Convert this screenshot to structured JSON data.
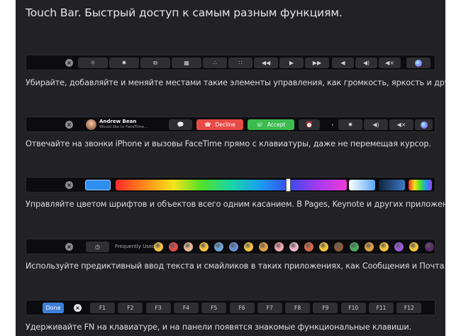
{
  "title": "Touch Bar. Быстрый доступ к самым разным функциям.",
  "rows": [
    {
      "caption": "Убирайте, добавляйте и меняйте местами такие элементы управления, как громкость, яркость и другие.",
      "keys": [
        "☼",
        "✹",
        "⧉",
        "▦",
        "∴",
        "∷",
        "◀◀",
        "▶",
        "▶▶",
        "◀",
        "◀)",
        "◀×"
      ]
    },
    {
      "caption": "Отвечайте на звонки iPhone и вызовы FaceTime прямо с клавиатуры, даже не перемещая курсор.",
      "caller_name": "Andrew Bean",
      "caller_status": "Would like to FaceTime…",
      "decline_label": "Decline",
      "accept_label": "Accept",
      "message_icon": "💬",
      "alarm_icon": "⏰",
      "controls": [
        "‹",
        "✹",
        "◀)",
        "◀×"
      ]
    },
    {
      "caption": "Управляйте цветом шрифтов и объектов всего одним касанием. В Pages, Keynote и других приложениях.",
      "selected_color": "#2f8ff0"
    },
    {
      "caption": "Используйте предиктивный ввод текста и смайликов в таких приложениях, как Сообщения и Почта.",
      "frequently_used_label": "Frequently Used",
      "emoji_colors": [
        "#f5c33b",
        "#e24a4a",
        "#e8b996",
        "#f5c33b",
        "#6ea6d6",
        "#6b8fd6",
        "#f5c33b",
        "#e0a040",
        "#f2a7b4",
        "#f0b7c8",
        "#d86a4a",
        "#f5c33b",
        "#8a5a3a",
        "#4aa860",
        "#e0a040",
        "#f5c33b",
        "#9b59d6",
        "#f5c33b",
        "#5a2a6a"
      ]
    },
    {
      "caption": "Удерживайте FN на клавиатуре, и на панели появятся знакомые функциональные клавиши.",
      "done_label": "Done",
      "fkeys": [
        "F1",
        "F2",
        "F3",
        "F4",
        "F5",
        "F6",
        "F7",
        "F8",
        "F9",
        "F10",
        "F11",
        "F12"
      ]
    }
  ],
  "colors": {
    "decline": "#e74b47",
    "accept": "#3dbb4f",
    "done": "#3d7fd6"
  }
}
